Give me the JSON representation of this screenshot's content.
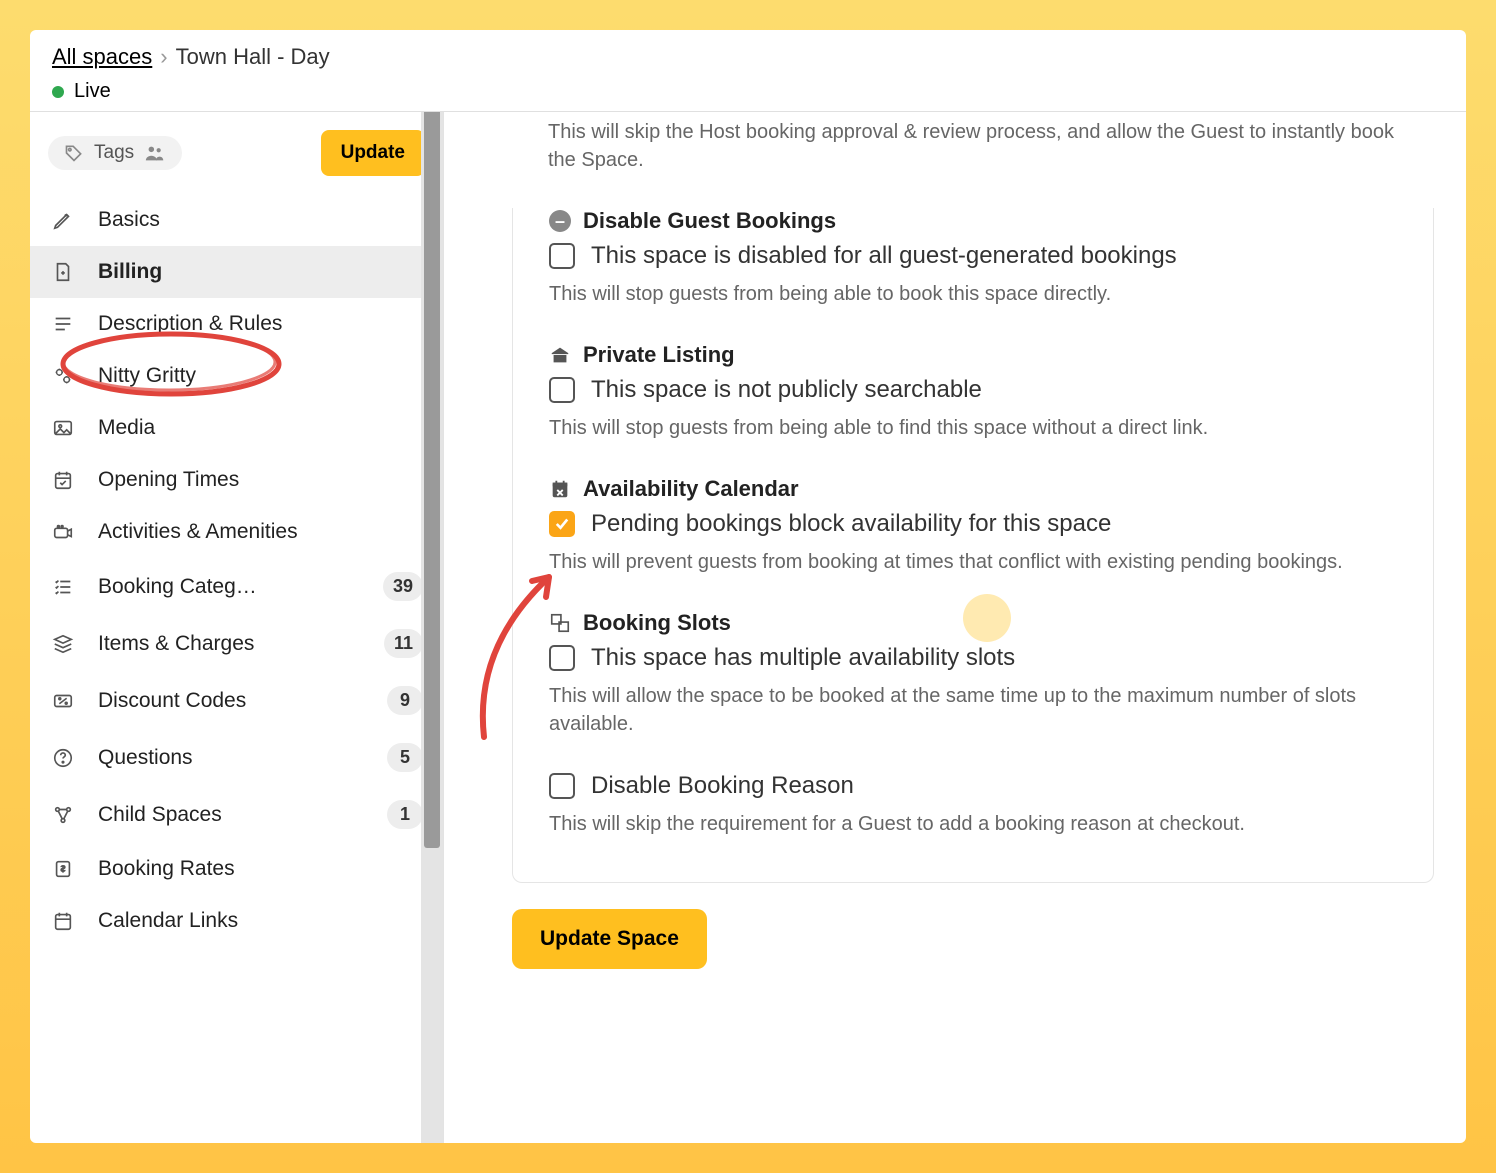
{
  "colors": {
    "accent": "#ffbf1f"
  },
  "header": {
    "breadcrumb_root": "All spaces",
    "breadcrumb_current": "Town Hall - Day",
    "status_label": "Live"
  },
  "topbar": {
    "tags_label": "Tags",
    "update_label": "Update"
  },
  "sidebar": {
    "items": [
      {
        "label": "Basics",
        "badge": ""
      },
      {
        "label": "Billing",
        "badge": "",
        "active": true
      },
      {
        "label": "Description & Rules",
        "badge": ""
      },
      {
        "label": "Nitty Gritty",
        "badge": ""
      },
      {
        "label": "Media",
        "badge": ""
      },
      {
        "label": "Opening Times",
        "badge": ""
      },
      {
        "label": "Activities & Amenities",
        "badge": ""
      },
      {
        "label": "Booking Categ…",
        "badge": "39"
      },
      {
        "label": "Items & Charges",
        "badge": "11"
      },
      {
        "label": "Discount Codes",
        "badge": "9"
      },
      {
        "label": "Questions",
        "badge": "5"
      },
      {
        "label": "Child Spaces",
        "badge": "1"
      },
      {
        "label": "Booking Rates",
        "badge": ""
      },
      {
        "label": "Calendar Links",
        "badge": ""
      }
    ]
  },
  "main": {
    "instant_help": "This will skip the Host booking approval & review process, and allow the Guest to instantly book the Space.",
    "sections": [
      {
        "title": "Disable Guest Bookings",
        "option": "This space is disabled for all guest-generated bookings",
        "checked": false,
        "help": "This will stop guests from being able to book this space directly."
      },
      {
        "title": "Private Listing",
        "option": "This space is not publicly searchable",
        "checked": false,
        "help": "This will stop guests from being able to find this space without a direct link."
      },
      {
        "title": "Availability Calendar",
        "option": "Pending bookings block availability for this space",
        "checked": true,
        "help": "This will prevent guests from booking at times that conflict with existing pending bookings."
      },
      {
        "title": "Booking Slots",
        "option": "This space has multiple availability slots",
        "checked": false,
        "help": "This will allow the space to be booked at the same time up to the maximum number of slots available."
      },
      {
        "title": "",
        "option": "Disable Booking Reason",
        "checked": false,
        "help": "This will skip the requirement for a Guest to add a booking reason at checkout."
      }
    ],
    "update_space_label": "Update Space"
  }
}
